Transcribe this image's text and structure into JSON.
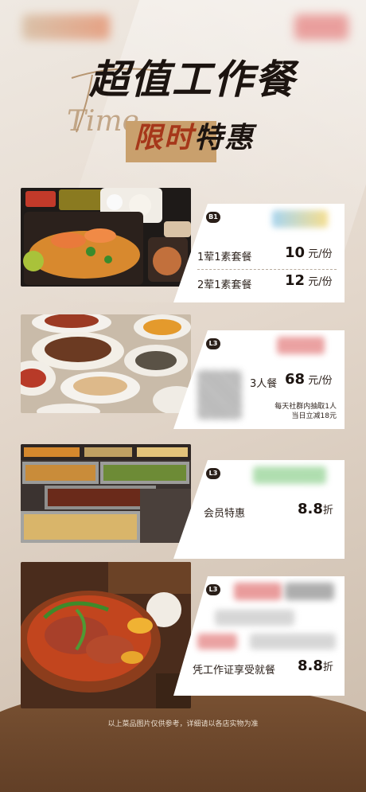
{
  "header": {
    "title": "超值工作餐",
    "script_text": "Time",
    "subtitle_highlight": "限时",
    "subtitle_rest": "特惠"
  },
  "cards": [
    {
      "badge": "B1",
      "rows": [
        {
          "label": "1荤1素套餐",
          "price": "10",
          "unit": "元/份"
        },
        {
          "label": "2荤1素套餐",
          "price": "12",
          "unit": "元/份"
        }
      ]
    },
    {
      "badge": "L3",
      "label": "3人餐",
      "price": "68",
      "unit": "元/份",
      "note_line1": "每天社群内抽取1人",
      "note_line2": "当日立减18元"
    },
    {
      "badge": "L3",
      "label": "会员特惠",
      "price": "8.8",
      "unit": "折"
    },
    {
      "badge": "L3",
      "label": "凭工作证享受就餐",
      "price": "8.8",
      "unit": "折"
    }
  ],
  "footer": "以上菜品图片仅供参考，详细请以各店实物为准",
  "colors": {
    "accent": "#c9a06d",
    "highlight": "#a6371a",
    "brown": "#6e4a2f",
    "ink": "#1c1410"
  }
}
